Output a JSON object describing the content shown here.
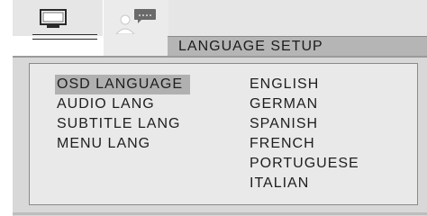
{
  "tabs": [
    {
      "name": "tv-setup",
      "icon": "tv-icon"
    },
    {
      "name": "language-setup",
      "icon": "person-speech-icon",
      "selected": true
    }
  ],
  "header": {
    "title": "LANGUAGE SETUP"
  },
  "menu": {
    "items": [
      {
        "label": "OSD LANGUAGE",
        "selected": true
      },
      {
        "label": "AUDIO LANG",
        "selected": false
      },
      {
        "label": "SUBTITLE LANG",
        "selected": false
      },
      {
        "label": "MENU LANG",
        "selected": false
      }
    ]
  },
  "options": {
    "items": [
      "ENGLISH",
      "GERMAN",
      "SPANISH",
      "FRENCH",
      "PORTUGUESE",
      "ITALIAN"
    ]
  },
  "colors": {
    "tab_background": "#e6e6e6",
    "header_background": "#b5b5b5",
    "panel_background": "#d8d8d8",
    "selection_highlight": "#b0b0b0",
    "text": "#1e1e1e"
  }
}
